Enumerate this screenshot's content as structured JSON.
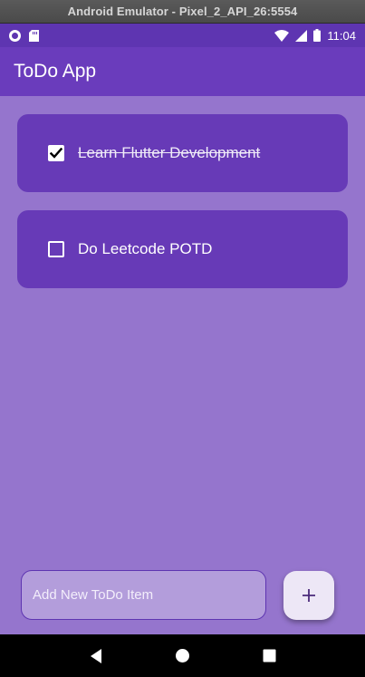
{
  "window": {
    "title": "Android Emulator - Pixel_2_API_26:5554"
  },
  "status_bar": {
    "time": "11:04"
  },
  "app_bar": {
    "title": "ToDo App"
  },
  "todos": [
    {
      "text": "Learn Flutter Development",
      "checked": true
    },
    {
      "text": "Do Leetcode POTD",
      "checked": false
    }
  ],
  "input": {
    "placeholder": "Add New ToDo Item",
    "value": ""
  },
  "add_button": {
    "icon": "plus-icon"
  },
  "colors": {
    "status_bar": "#5e35b1",
    "app_bar": "#6a3cbc",
    "background": "#9575cd",
    "card": "#673ab7",
    "input_fill": "#b39ddb",
    "fab": "#ede7f6"
  }
}
